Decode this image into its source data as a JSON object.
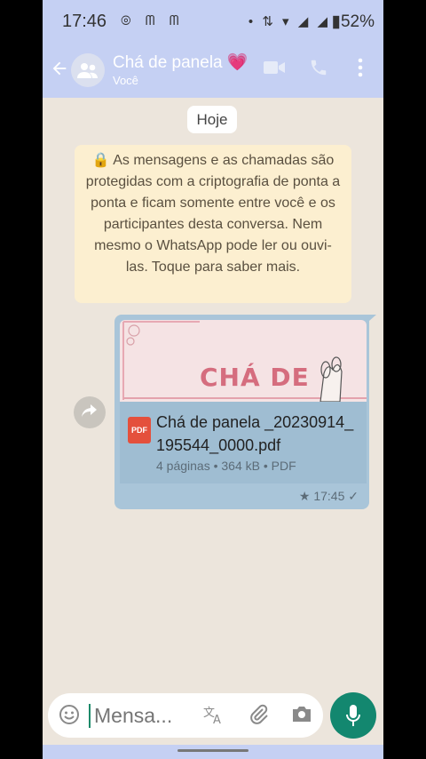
{
  "status_bar": {
    "time": "17:46",
    "left_icons": "⊚ ᗰ ᗰ",
    "right_icons": "• ⇅ ▾ ◢ ◢",
    "battery": "▮52%"
  },
  "header": {
    "back_icon": "arrow-back",
    "title": "Chá de panela 💗",
    "subtitle": "Você",
    "video_icon": "video-camera",
    "call_icon": "phone",
    "menu_icon": "more-vertical"
  },
  "chat": {
    "date_chip": "Hoje",
    "encryption_notice": "🔒 As mensagens e as chamadas são protegidas com a criptografia de ponta a ponta e ficam somente entre você e os participantes desta conversa. Nem mesmo o WhatsApp pode ler ou ouvi-las. Toque para saber mais.",
    "message": {
      "preview_title": "CHÁ DE",
      "file_badge": "PDF",
      "file_name": "Chá de panela _20230914_195544_0000.pdf",
      "file_meta": "4 páginas • 364 kB • PDF",
      "time": "★ 17:45 ✓"
    }
  },
  "input": {
    "placeholder": "Mensa...",
    "emoji_icon": "emoji",
    "translate_icon": "translate",
    "attach_icon": "paperclip",
    "camera_icon": "camera",
    "mic_icon": "microphone"
  },
  "colors": {
    "header": "#c5d0f3",
    "bubble": "#a9c5d9",
    "notice": "#fcefd0",
    "mic": "#13876f"
  }
}
